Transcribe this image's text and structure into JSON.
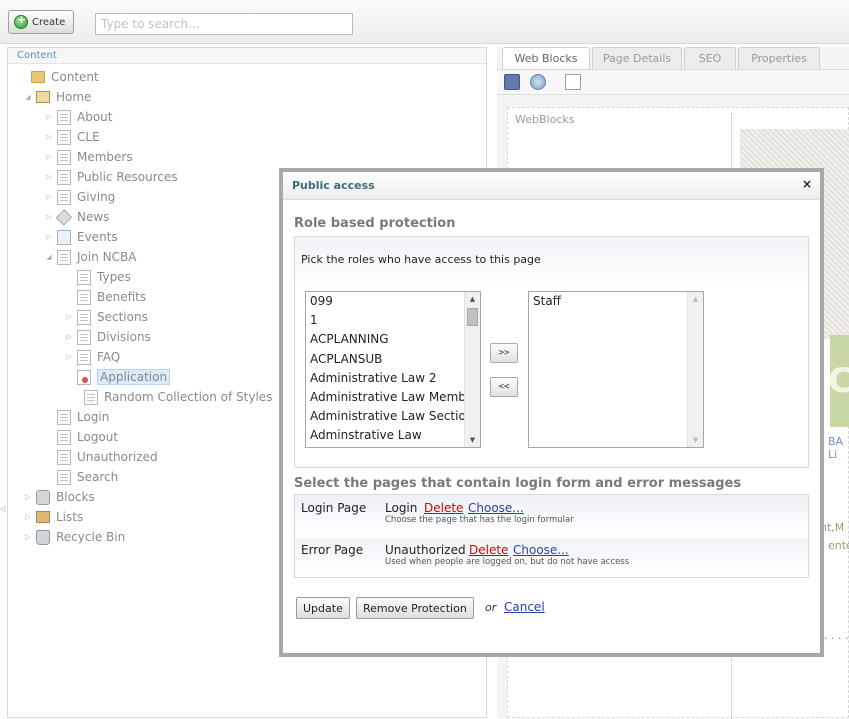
{
  "topbar": {
    "create_label": "Create",
    "search_placeholder": "Type to search..."
  },
  "tree": {
    "header": "Content",
    "nodes": [
      {
        "label": "Content",
        "icon": "folder-icon"
      },
      {
        "label": "Home",
        "icon": "home-icon"
      },
      {
        "label": "About",
        "icon": "page-icon"
      },
      {
        "label": "CLE",
        "icon": "page-icon"
      },
      {
        "label": "Members",
        "icon": "page-icon"
      },
      {
        "label": "Public Resources",
        "icon": "page-icon"
      },
      {
        "label": "Giving",
        "icon": "page-icon"
      },
      {
        "label": "News",
        "icon": "tag-icon"
      },
      {
        "label": "Events",
        "icon": "calendar-icon"
      },
      {
        "label": "Join NCBA",
        "icon": "page-icon"
      },
      {
        "label": "Types",
        "icon": "page-icon"
      },
      {
        "label": "Benefits",
        "icon": "page-icon"
      },
      {
        "label": "Sections",
        "icon": "page-icon"
      },
      {
        "label": "Divisions",
        "icon": "page-icon"
      },
      {
        "label": "FAQ",
        "icon": "page-icon"
      },
      {
        "label": "Application",
        "icon": "protected-page-icon"
      },
      {
        "label": "Random Collection of Styles",
        "icon": "page-icon"
      },
      {
        "label": "Login",
        "icon": "page-icon"
      },
      {
        "label": "Logout",
        "icon": "page-icon"
      },
      {
        "label": "Unauthorized",
        "icon": "page-icon"
      },
      {
        "label": "Search",
        "icon": "page-icon"
      },
      {
        "label": "Blocks",
        "icon": "blocks-icon"
      },
      {
        "label": "Lists",
        "icon": "lists-icon"
      },
      {
        "label": "Recycle Bin",
        "icon": "recycle-bin-icon"
      }
    ]
  },
  "editor": {
    "tabs": [
      "Web Blocks",
      "Page Details",
      "SEO",
      "Properties"
    ],
    "active_tab": "Web Blocks",
    "canvas_label": "WebBlocks",
    "canvas_fragments": {
      "big_letters": "CE",
      "link_fragment": "BA Li",
      "green_fragment": "nt,M",
      "green_fragment2": "ente",
      "dots": ". . . ."
    }
  },
  "modal": {
    "title": "Public access",
    "close_glyph": "×",
    "role_section_title": "Role based protection",
    "pick_text": "Pick the roles who have access to this page",
    "available_roles": [
      "099",
      "1",
      "ACPLANNING",
      "ACPLANSUB",
      "Administrative Law 2",
      "Administrative Law Member",
      "Administrative Law Section",
      "Adminstrative Law"
    ],
    "assigned_roles": [
      "Staff"
    ],
    "add_button": ">>",
    "remove_button": "<<",
    "pages_section_title": "Select the pages that contain login form and error messages",
    "login_page": {
      "label": "Login Page",
      "value": "Login",
      "delete": "Delete",
      "choose": "Choose...",
      "hint": "Choose the page that has the login formular"
    },
    "error_page": {
      "label": "Error Page",
      "value": "Unauthorized",
      "delete": "Delete",
      "choose": "Choose...",
      "hint": "Used when people are logged on, but do not have access"
    },
    "update_button": "Update",
    "remove_protection_button": "Remove Protection",
    "or_text": "or",
    "cancel_link": "Cancel"
  }
}
